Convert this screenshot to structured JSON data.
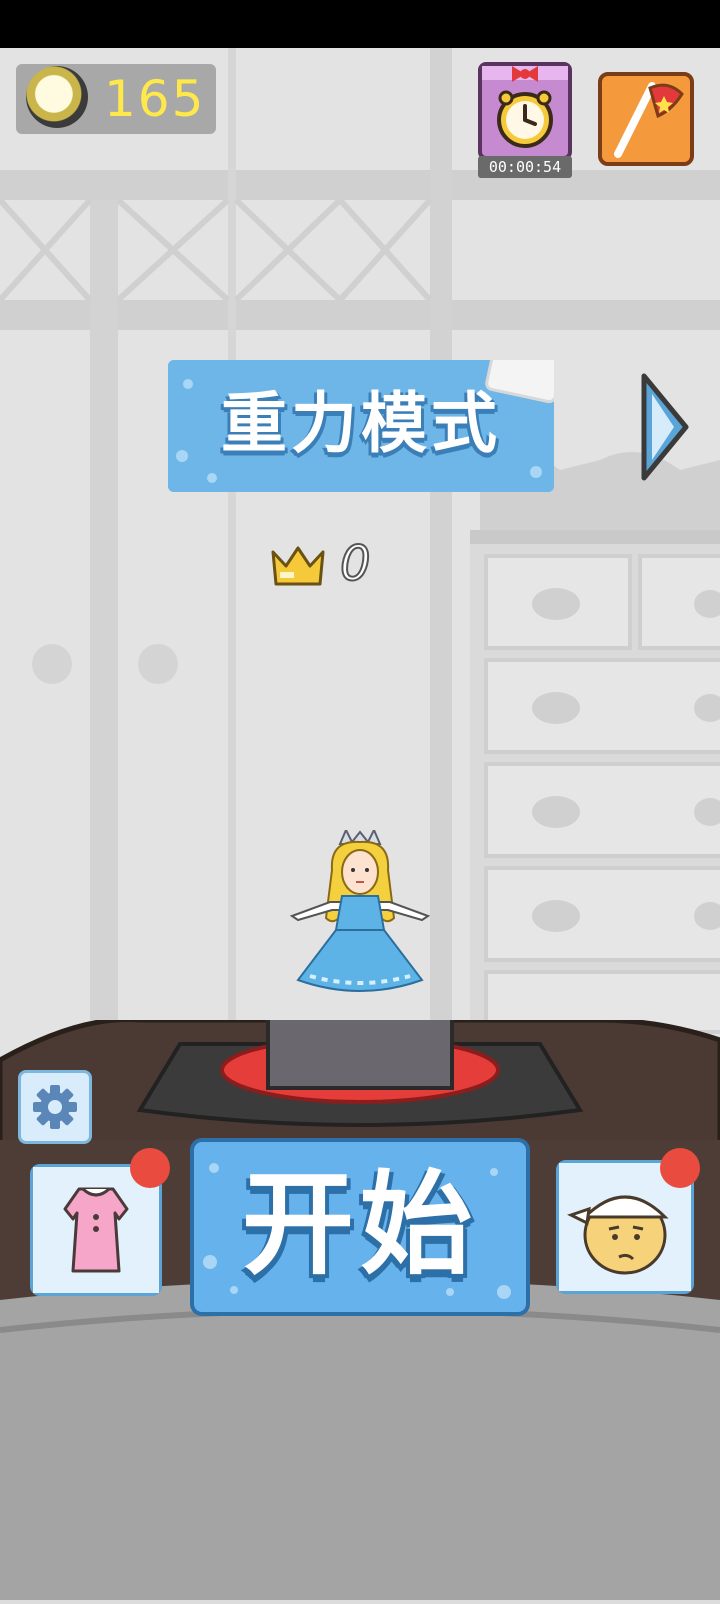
{
  "hud": {
    "coins": "165",
    "timer": "00:00:54"
  },
  "mode": {
    "title": "重力模式",
    "best_score": "0"
  },
  "actions": {
    "start_label": "开始"
  },
  "icons": {
    "coin": "coin-icon",
    "timer": "alarm-clock-icon",
    "flag": "flag-icon",
    "next": "chevron-right-icon",
    "crown": "crown-icon",
    "settings": "gear-icon",
    "dress": "dress-icon",
    "character": "character-icon"
  },
  "colors": {
    "accent_blue": "#66b2ec",
    "coin_text": "#ffe94a",
    "notification": "#e94b3e",
    "flag_orange": "#f59a3c",
    "timer_purple": "#c58ad0"
  }
}
